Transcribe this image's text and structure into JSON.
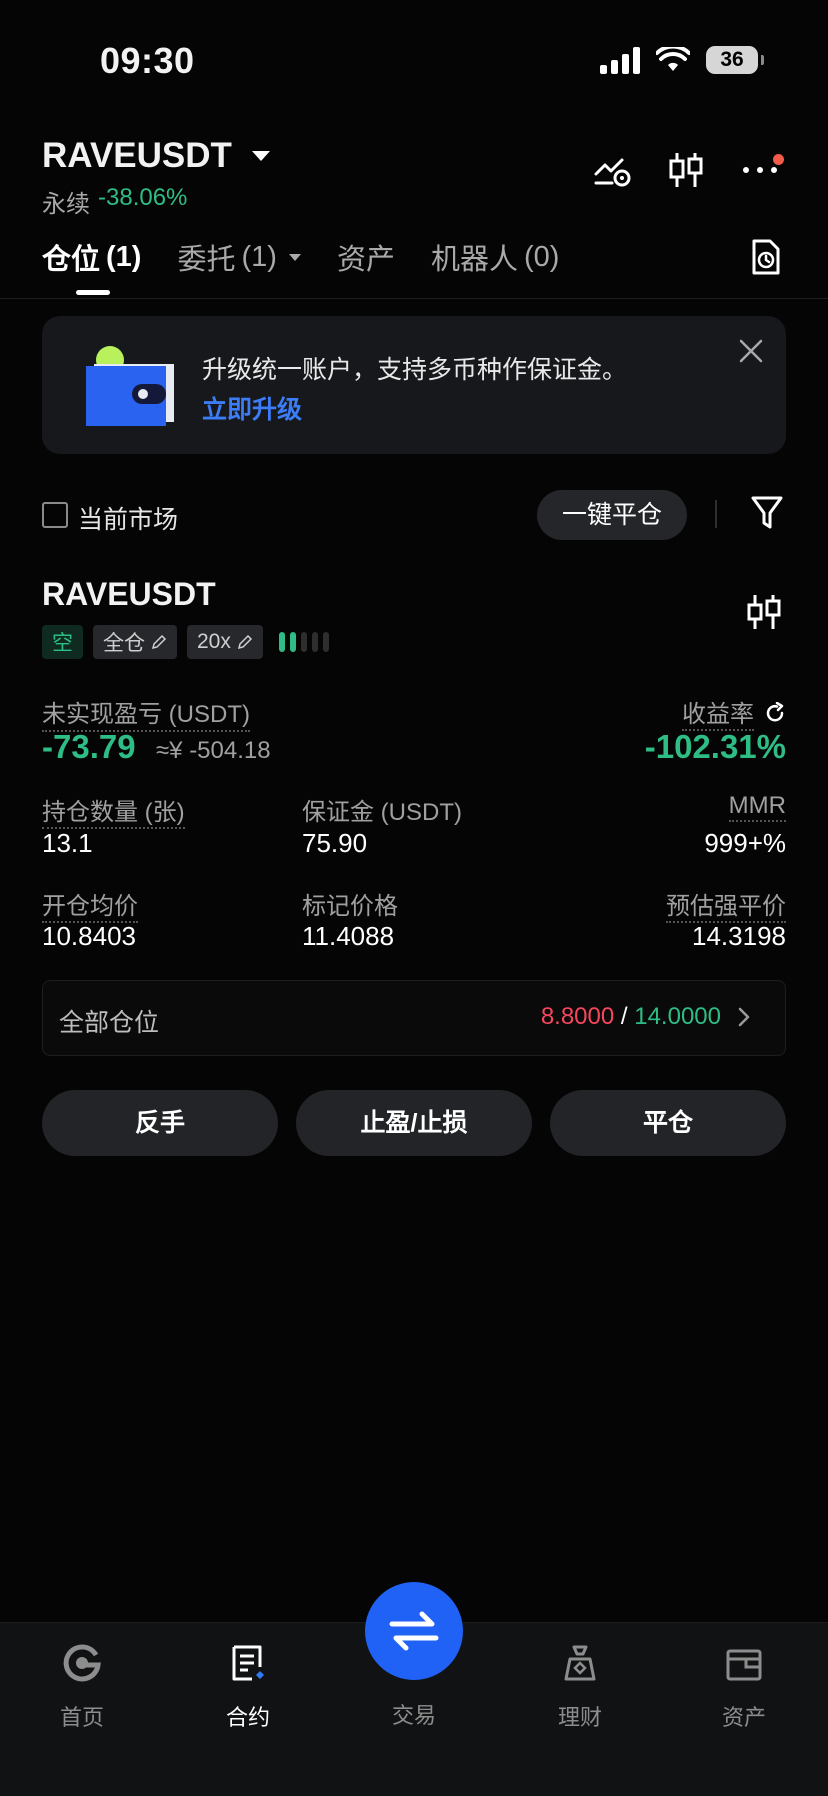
{
  "status_bar": {
    "time": "09:30",
    "battery": "36"
  },
  "header": {
    "symbol": "RAVEUSDT",
    "contract_type": "永续",
    "change_pct": "-38.06%"
  },
  "tabs": [
    {
      "label": "仓位",
      "count": "(1)"
    },
    {
      "label": "委托",
      "count": "(1)"
    },
    {
      "label": "资产",
      "count": ""
    },
    {
      "label": "机器人",
      "count": "(0)"
    }
  ],
  "banner": {
    "text": "升级统一账户，支持多币种作保证金。",
    "link": "立即升级"
  },
  "filter": {
    "current_market_label": "当前市场",
    "close_all_label": "一键平仓"
  },
  "position": {
    "symbol": "RAVEUSDT",
    "side_tag": "空",
    "margin_mode_tag": "全仓",
    "leverage_tag": "20x",
    "pnl_label": "未实现盈亏 (USDT)",
    "pnl_value": "-73.79",
    "pnl_cny": "≈¥ -504.18",
    "roi_label": "收益率",
    "roi_value": "-102.31%",
    "qty_label": "持仓数量 (张)",
    "qty_value": "13.1",
    "margin_label": "保证金 (USDT)",
    "margin_value": "75.90",
    "mmr_label": "MMR",
    "mmr_value": "999+%",
    "entry_label": "开仓均价",
    "entry_value": "10.8403",
    "mark_label": "标记价格",
    "mark_value": "11.4088",
    "liq_label": "预估强平价",
    "liq_value": "14.3198",
    "all_positions_label": "全部仓位",
    "all_positions_red": "8.8000",
    "all_positions_sep": "/",
    "all_positions_green": "14.0000"
  },
  "actions": {
    "reverse": "反手",
    "tp_sl": "止盈/止损",
    "close": "平仓"
  },
  "bottom_nav": {
    "home": "首页",
    "futures": "合约",
    "trade": "交易",
    "earn": "理财",
    "assets": "资产"
  },
  "colors": {
    "green": "#2ebd85",
    "red": "#f6465d",
    "orange": "#f7a559",
    "accent_blue": "#1f62f5"
  }
}
